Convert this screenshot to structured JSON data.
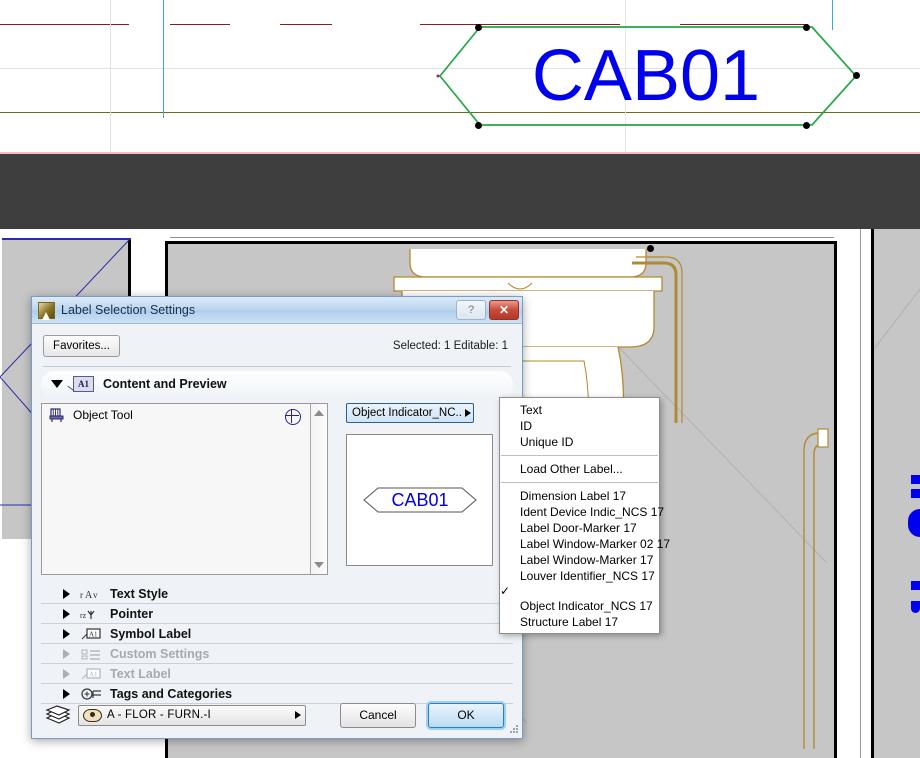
{
  "canvas": {
    "big_label_text": "CAB01",
    "label_outline_color": "#22aa44",
    "label_text_color": "#0000ee",
    "band_color": "#3e3e3e",
    "room_fill": "#c6c6c6",
    "fixture_line_color": "#b08a32"
  },
  "dialog": {
    "title": "Label Selection Settings",
    "help_button": "?",
    "close_button": "✕",
    "favorites_button": "Favorites...",
    "selection_info": "Selected: 1 Editable: 1",
    "content_section": {
      "title": "Content and Preview",
      "icon_text": "A1",
      "object_tool_label": "Object Tool",
      "label_combo_value": "Object Indicator_NC...",
      "preview_text": "CAB01"
    },
    "sections": [
      {
        "label": "Text Style",
        "enabled": true
      },
      {
        "label": "Pointer",
        "enabled": true
      },
      {
        "label": "Symbol Label",
        "enabled": true
      },
      {
        "label": "Custom Settings",
        "enabled": false
      },
      {
        "label": "Text Label",
        "enabled": false
      },
      {
        "label": "Tags and Categories",
        "enabled": true
      }
    ],
    "footer": {
      "layer_value": "A - FLOR - FURN.-I",
      "cancel_label": "Cancel",
      "ok_label": "OK"
    }
  },
  "dropdown": {
    "group_one": [
      "Text",
      "ID",
      "Unique ID"
    ],
    "group_two": [
      "Load Other Label..."
    ],
    "group_three": [
      {
        "label": "Dimension Label 17",
        "checked": false
      },
      {
        "label": "Ident Device Indic_NCS 17",
        "checked": false
      },
      {
        "label": "Label Door-Marker 17",
        "checked": false
      },
      {
        "label": "Label Window-Marker 02 17",
        "checked": false
      },
      {
        "label": "Label Window-Marker 17",
        "checked": false
      },
      {
        "label": "Louver Identifier_NCS 17",
        "checked": false
      },
      {
        "label": "Object Indicator_NCS 17",
        "checked": true
      },
      {
        "label": "Structure Label 17",
        "checked": false
      }
    ],
    "check_glyph": "✓"
  }
}
